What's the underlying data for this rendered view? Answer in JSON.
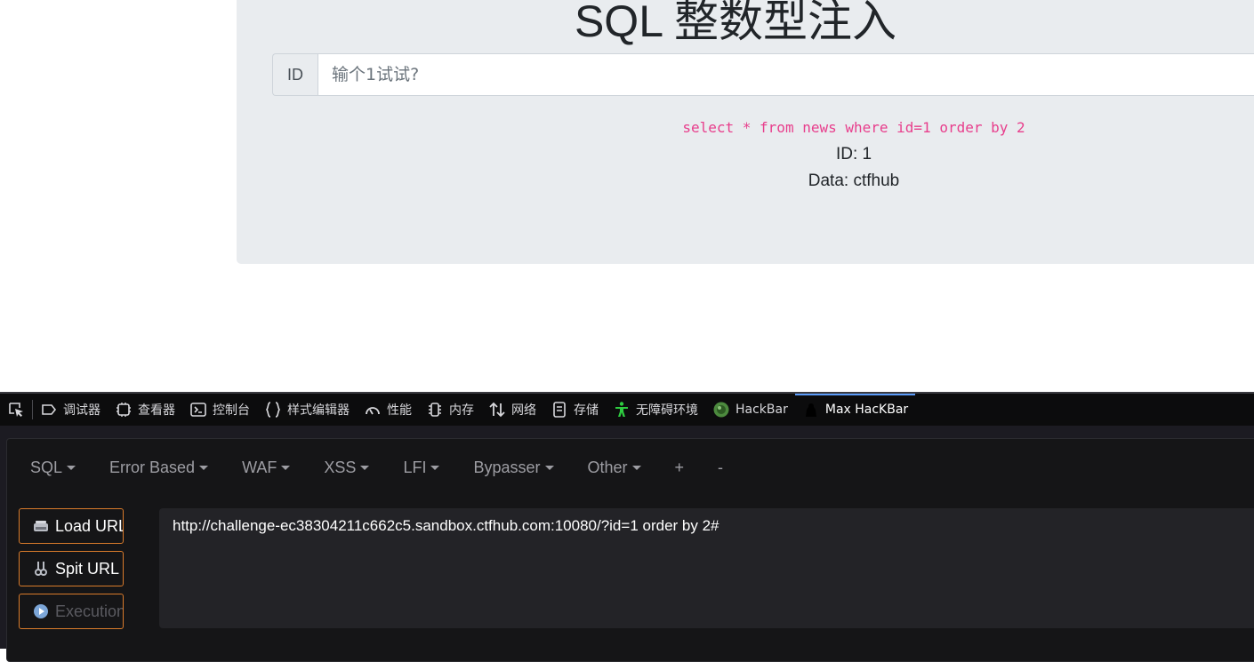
{
  "page": {
    "title": "SQL 整数型注入",
    "input_prefix": "ID",
    "input_placeholder": "输个1试试?",
    "input_value": "",
    "query": "select * from news where id=1 order by 2",
    "result_id": "ID: 1",
    "result_data": "Data: ctfhub"
  },
  "devtools": {
    "tabs": [
      {
        "label": "调试器",
        "icon": "debugger-icon"
      },
      {
        "label": "查看器",
        "icon": "inspector-icon"
      },
      {
        "label": "控制台",
        "icon": "console-icon"
      },
      {
        "label": "样式编辑器",
        "icon": "style-editor-icon"
      },
      {
        "label": "性能",
        "icon": "performance-icon"
      },
      {
        "label": "内存",
        "icon": "memory-icon"
      },
      {
        "label": "网络",
        "icon": "network-icon"
      },
      {
        "label": "存储",
        "icon": "storage-icon"
      },
      {
        "label": "无障碍环境",
        "icon": "accessibility-icon"
      },
      {
        "label": "HackBar",
        "icon": "hackbar-icon"
      },
      {
        "label": "Max HacKBar",
        "icon": "max-hackbar-icon",
        "active": true
      }
    ]
  },
  "hackbar": {
    "menu": [
      "SQL",
      "Error Based",
      "WAF",
      "XSS",
      "LFI",
      "Bypasser",
      "Other",
      "+",
      "-"
    ],
    "load_url": "Load URL",
    "split_url": "Spit URL",
    "execution": "Execution",
    "url": "http://challenge-ec38304211c662c5.sandbox.ctfhub.com:10080/?id=1 order by 2#"
  },
  "colors": {
    "query_pink": "#e83e8c",
    "button_border": "#d97b2b",
    "active_tab": "#5b9bf8",
    "accessibility_green": "#2ecc40"
  }
}
